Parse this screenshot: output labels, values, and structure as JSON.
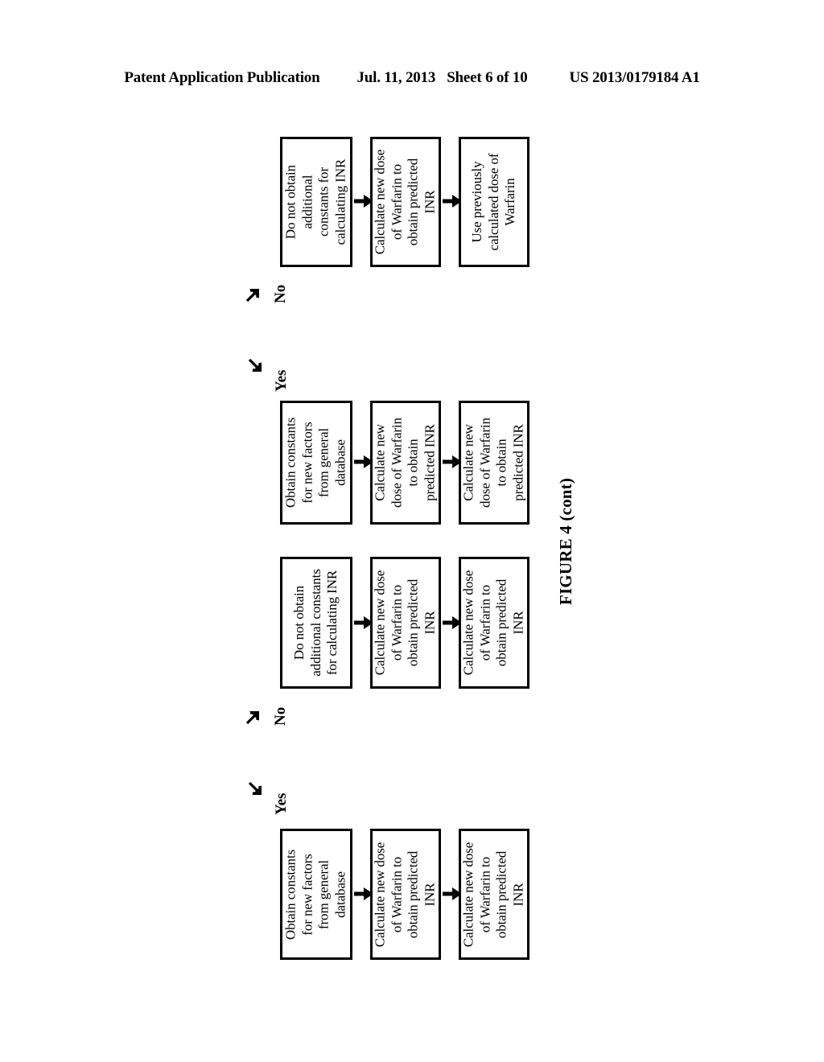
{
  "header": {
    "publication": "Patent Application Publication",
    "date": "Jul. 11, 2013",
    "sheet": "Sheet 6 of 10",
    "number": "US 2013/0179184 A1"
  },
  "figure": {
    "caption": "FIGURE 4 (cont)",
    "branches": [
      {
        "id": "branch-no-top",
        "label": "No",
        "arrow": "arrow-up-right"
      },
      {
        "id": "branch-yes-top",
        "label": "Yes",
        "arrow": "arrow-down-right"
      },
      {
        "id": "branch-no-bottom",
        "label": "No",
        "arrow": "arrow-up-right"
      },
      {
        "id": "branch-yes-bottom",
        "label": "Yes",
        "arrow": "arrow-down-right"
      }
    ],
    "groups": [
      {
        "id": "group-no-top",
        "nodes": [
          {
            "id": "node-1-1",
            "text": "Do not obtain\nadditional\nconstants for\ncalculating INR"
          },
          {
            "id": "node-1-2",
            "text": "Calculate new dose\nof Warfarin to\nobtain predicted\nINR"
          },
          {
            "id": "node-1-3",
            "text": "Use previously\ncalculated dose of\nWarfarin"
          }
        ]
      },
      {
        "id": "group-yes-top",
        "nodes": [
          {
            "id": "node-2-1",
            "text": "Obtain constants\nfor new factors\nfrom general\ndatabase"
          },
          {
            "id": "node-2-2",
            "text": "Calculate new\ndose of Warfarin\nto obtain\npredicted INR"
          },
          {
            "id": "node-2-3",
            "text": "Calculate new\ndose of Warfarin\nto obtain\npredicted INR"
          }
        ]
      },
      {
        "id": "group-no-bottom",
        "nodes": [
          {
            "id": "node-3-1",
            "text": "Do not obtain\nadditional constants\nfor calculating INR"
          },
          {
            "id": "node-3-2",
            "text": "Calculate new dose\nof Warfarin to\nobtain predicted\nINR"
          },
          {
            "id": "node-3-3",
            "text": "Calculate new dose\nof Warfarin to\nobtain predicted\nINR"
          }
        ]
      },
      {
        "id": "group-yes-bottom",
        "nodes": [
          {
            "id": "node-4-1",
            "text": "Obtain constants\nfor new factors\nfrom general\ndatabase"
          },
          {
            "id": "node-4-2",
            "text": "Calculate new dose\nof Warfarin to\nobtain predicted\nINR"
          },
          {
            "id": "node-4-3",
            "text": "Calculate new dose\nof Warfarin to\nobtain predicted\nINR"
          }
        ]
      }
    ]
  }
}
